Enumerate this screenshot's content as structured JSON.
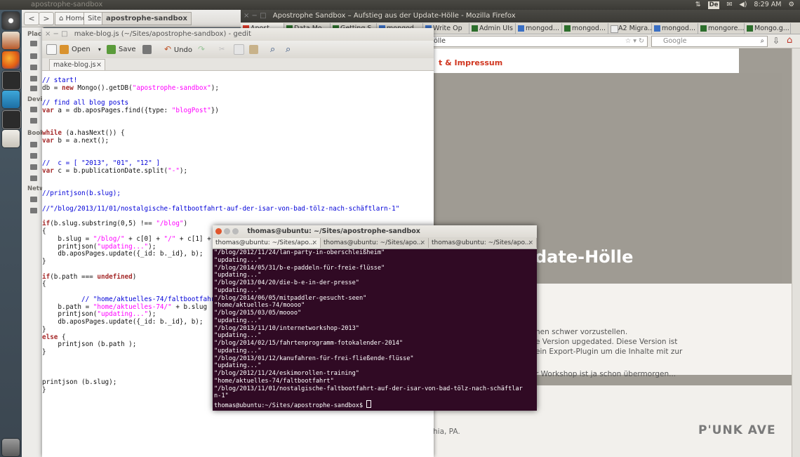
{
  "top_panel": {
    "active_window_title": "apostrophe-sandbox",
    "keyboard_layout": "De",
    "clock": "8:29 AM"
  },
  "nautilus": {
    "back_label": "<",
    "forward_label": ">",
    "breadcrumbs": [
      "Home",
      "Sites",
      "apostrophe-sandbox"
    ],
    "sidebar_sections": [
      "Plac",
      "Devi",
      "Book",
      "Netw"
    ]
  },
  "firefox": {
    "title": "Apostrophe Sandbox – Aufstieg aus der Update-Hölle - Mozilla Firefox",
    "tabs": [
      "Apost",
      "Data Mo",
      "Getting S",
      "mongod",
      "Write Op",
      "Admin UIs",
      "mongod...",
      "mongod...",
      "A2 Migra...",
      "mongod...",
      "mongore...",
      "Mongo.g..."
    ],
    "url_fragment": "ölle",
    "search_placeholder": "Google",
    "page_nav_link": "t & Impressum",
    "page_heading_fragment": "date-Hölle",
    "page_text_lines": [
      "nen schwer vorzustellen.",
      "e Version upgedated. Diese Version ist",
      "ein Export-Plugin um die Inhalte mit zur",
      "r Workshop ist ja schon übermorgen..."
    ],
    "footer_text": "hia, PA.",
    "footer_logo": "P'UNK AVE"
  },
  "gedit": {
    "title": "make-blog.js (~/Sites/apostrophe-sandbox) - gedit",
    "toolbar": {
      "open": "Open",
      "save": "Save",
      "undo": "Undo"
    },
    "tab_label": "make-blog.js",
    "code_lines": [
      "// start!",
      "db = new Mongo().getDB(\"apostrophe-sandbox\");",
      "",
      "// find all blog posts",
      "var a = db.aposPages.find({type: \"blogPost\"})",
      "",
      "",
      "while (a.hasNext()) {",
      "var b = a.next();",
      "",
      "",
      "//  c = [ \"2013\", \"01\", \"12\" ]",
      "var c = b.publicationDate.split(\"-\");",
      "",
      "",
      "//printjson(b.slug);",
      "",
      "//\"/blog/2013/11/01/nostalgische-faltbootfahrt-auf-der-isar-von-bad-tölz-nach-schäftlarn-1\"",
      "",
      "if(b.slug.substring(0,5) !== \"/blog\")",
      "{",
      "    b.slug = \"/blog/\" + c[0] + \"/\" + c[1] + \"",
      "    printjson(\"updating...\");",
      "    db.aposPages.update({_id: b._id}, b);",
      "}",
      "",
      "if(b.path === undefined)",
      "{",
      "",
      "          // \"home/aktuelles-74/faltbootfahrt",
      "    b.path = \"home/aktuelles-74/\" + b.slug",
      "    printjson(\"updating...\");",
      "    db.aposPages.update({_id: b._id}, b);",
      "}",
      "else {",
      "    printjson (b.path );",
      "}",
      "",
      "",
      "",
      "printjson (b.slug);",
      "}"
    ]
  },
  "terminal": {
    "title": "thomas@ubuntu: ~/Sites/apostrophe-sandbox",
    "tabs": [
      "thomas@ubuntu: ~/Sites/apo...",
      "thomas@ubuntu: ~/Sites/apo...",
      "thomas@ubuntu: ~/Sites/apo..."
    ],
    "output_lines": [
      "\"/blog/2012/11/24/lan-party-in-oberschleißheim\"",
      "\"updating...\"",
      "\"/blog/2014/05/31/b-e-paddeln-für-freie-flüsse\"",
      "\"updating...\"",
      "\"/blog/2013/04/20/die-b-e-in-der-presse\"",
      "\"updating...\"",
      "\"/blog/2014/06/05/mitpaddler-gesucht-seen\"",
      "\"home/aktuelles-74/moooo\"",
      "\"/blog/2015/03/05/moooo\"",
      "\"updating...\"",
      "\"/blog/2013/11/10/internetworkshop-2013\"",
      "\"updating...\"",
      "\"/blog/2014/02/15/fahrtenprogramm-fotokalender-2014\"",
      "\"updating...\"",
      "\"/blog/2013/01/12/kanufahren-für-frei-fließende-flüsse\"",
      "\"updating...\"",
      "\"/blog/2012/11/24/eskimorollen-training\"",
      "\"home/aktuelles-74/faltbootfahrt\"",
      "\"/blog/2013/11/01/nostalgische-faltbootfahrt-auf-der-isar-von-bad-tölz-nach-schäftlar",
      "n-1\""
    ],
    "prompt": "thomas@ubuntu:~/Sites/apostrophe-sandbox$ "
  }
}
